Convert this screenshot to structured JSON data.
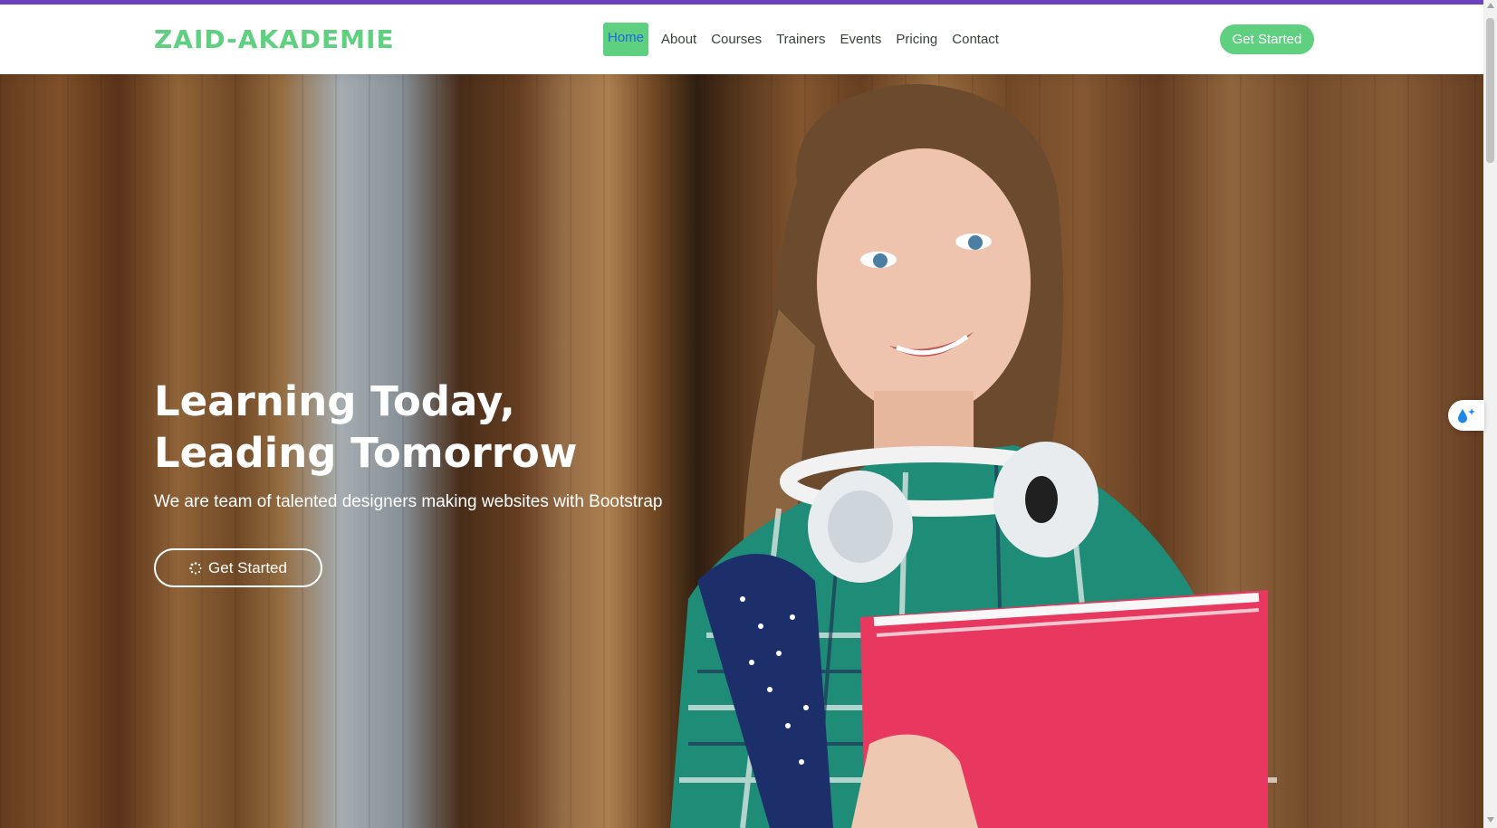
{
  "brand": {
    "name": "ZAID-AKADEMIE"
  },
  "nav": {
    "items": [
      {
        "label": "Home",
        "active": true
      },
      {
        "label": "About"
      },
      {
        "label": "Courses"
      },
      {
        "label": "Trainers"
      },
      {
        "label": "Events"
      },
      {
        "label": "Pricing"
      },
      {
        "label": "Contact"
      }
    ],
    "cta_label": "Get Started"
  },
  "hero": {
    "title_line1": "Learning Today,",
    "title_line2": "Leading Tomorrow",
    "subtitle": "We are team of talented designers making websites with Bootstrap",
    "button_label": "Get Started",
    "button_icon": "spinner-icon"
  },
  "widget": {
    "icon": "droplet-sparkle-icon"
  },
  "colors": {
    "accent": "#5fcf80",
    "top_bar": "#6f42c1",
    "active_nav_text": "#1d6ae5",
    "nav_text": "#37423b"
  }
}
